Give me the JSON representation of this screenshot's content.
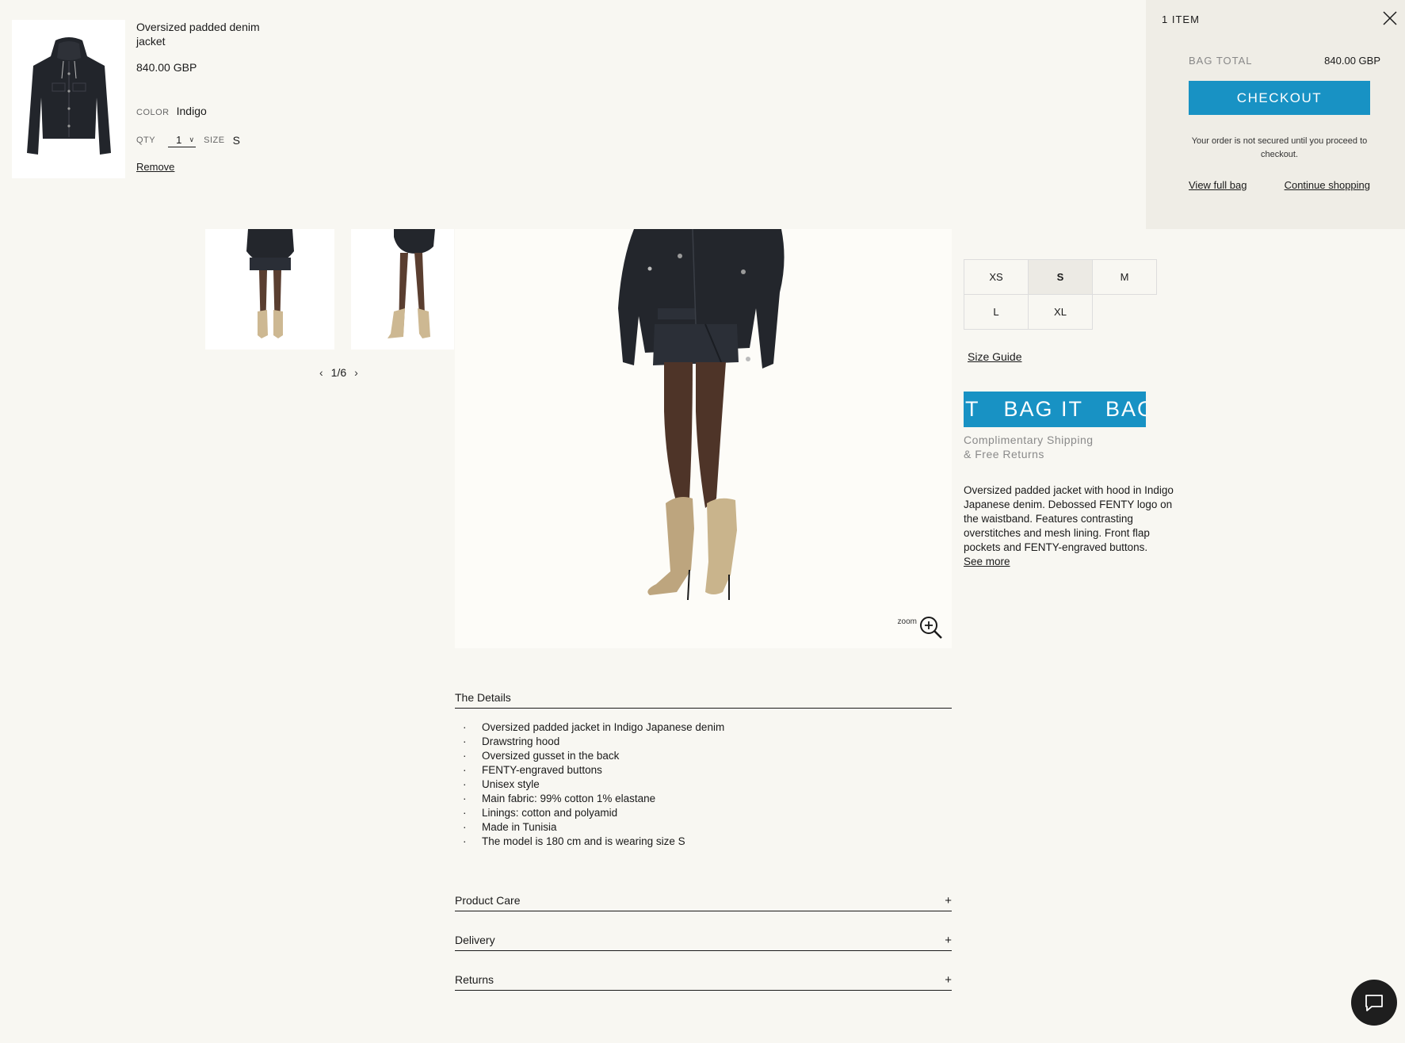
{
  "bag_preview": {
    "item_name": "Oversized padded denim jacket",
    "price": "840.00 GBP",
    "color_label": "COLOR",
    "color_value": "Indigo",
    "qty_label": "QTY",
    "qty_value": "1",
    "size_label": "SIZE",
    "size_value": "S",
    "remove_label": "Remove"
  },
  "mini_bag": {
    "item_count": "1 ITEM",
    "total_label": "BAG TOTAL",
    "total_value": "840.00 GBP",
    "checkout_label": "CHECKOUT",
    "note": "Your order is not secured until you proceed to checkout.",
    "view_full_bag": "View full bag",
    "continue_shopping": "Continue shopping",
    "close_icon": "close-icon"
  },
  "gallery": {
    "pager_current": "1",
    "pager_sep": "/",
    "pager_total": "6",
    "zoom_label": "zoom"
  },
  "sizes": [
    {
      "label": "XS",
      "selected": false
    },
    {
      "label": "S",
      "selected": true
    },
    {
      "label": "M",
      "selected": false
    },
    {
      "label": "L",
      "selected": false
    },
    {
      "label": "XL",
      "selected": false
    }
  ],
  "size_guide": "Size Guide",
  "bag_it": {
    "label_partial": "T",
    "label_1": "BAG IT",
    "label_2": "BAG IT",
    "color": "#1892c4"
  },
  "shipping_note_1": "Complimentary Shipping",
  "shipping_note_2": "& Free Returns",
  "description": "Oversized padded jacket with hood in Indigo Japanese denim. Debossed FENTY logo on the waistband. Features contrasting overstitches and mesh lining. Front flap pockets and FENTY-engraved buttons.",
  "see_more": "See more",
  "details": {
    "title": "The Details",
    "items": [
      "Oversized padded jacket in Indigo Japanese denim",
      "Drawstring hood",
      "Oversized gusset in the back",
      "FENTY-engraved buttons",
      "Unisex style",
      "Main fabric: 99% cotton 1% elastane",
      "Linings: cotton and polyamid",
      "Made in Tunisia",
      "The model is 180 cm and is wearing size S"
    ]
  },
  "accordions": [
    {
      "label": "Product Care",
      "icon": "+"
    },
    {
      "label": "Delivery",
      "icon": "+"
    },
    {
      "label": "Returns",
      "icon": "+"
    }
  ],
  "chat_icon": "chat-bubble-icon",
  "colors": {
    "accent": "#1892c4",
    "background": "#f8f7f2",
    "panel": "#efede6"
  }
}
